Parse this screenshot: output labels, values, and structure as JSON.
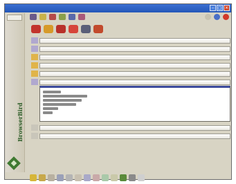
{
  "window": {
    "title": "",
    "controls": {
      "minimize": "–",
      "maximize": "□",
      "close": "×"
    }
  },
  "toolbar": {
    "icons": [
      "tool-a",
      "tool-b",
      "tool-c",
      "tool-d",
      "tool-e",
      "tool-f"
    ],
    "right_icons": [
      "pencil",
      "globe",
      "stop"
    ]
  },
  "icon_row": {
    "icons": [
      "car-red",
      "cup",
      "boot-red",
      "glass",
      "clip",
      "tennis"
    ]
  },
  "fields": [
    {
      "icon": "person-icon",
      "value": ""
    },
    {
      "icon": "person-icon",
      "value": ""
    },
    {
      "icon": "pencil-icon",
      "value": ""
    },
    {
      "icon": "pencil-icon",
      "value": ""
    },
    {
      "icon": "pencil-icon",
      "value": ""
    },
    {
      "icon": "person-icon",
      "value": ""
    }
  ],
  "lower_fields": [
    {
      "icon": "doc-icon",
      "value": ""
    },
    {
      "icon": "doc-icon",
      "value": ""
    }
  ],
  "brand": {
    "name": "BrowserBird"
  },
  "bottom": {
    "label": ""
  },
  "colors": {
    "titlebar": "#2f63c6",
    "accent_blue": "#3c4a9c",
    "brand_green": "#2f5e2a"
  }
}
